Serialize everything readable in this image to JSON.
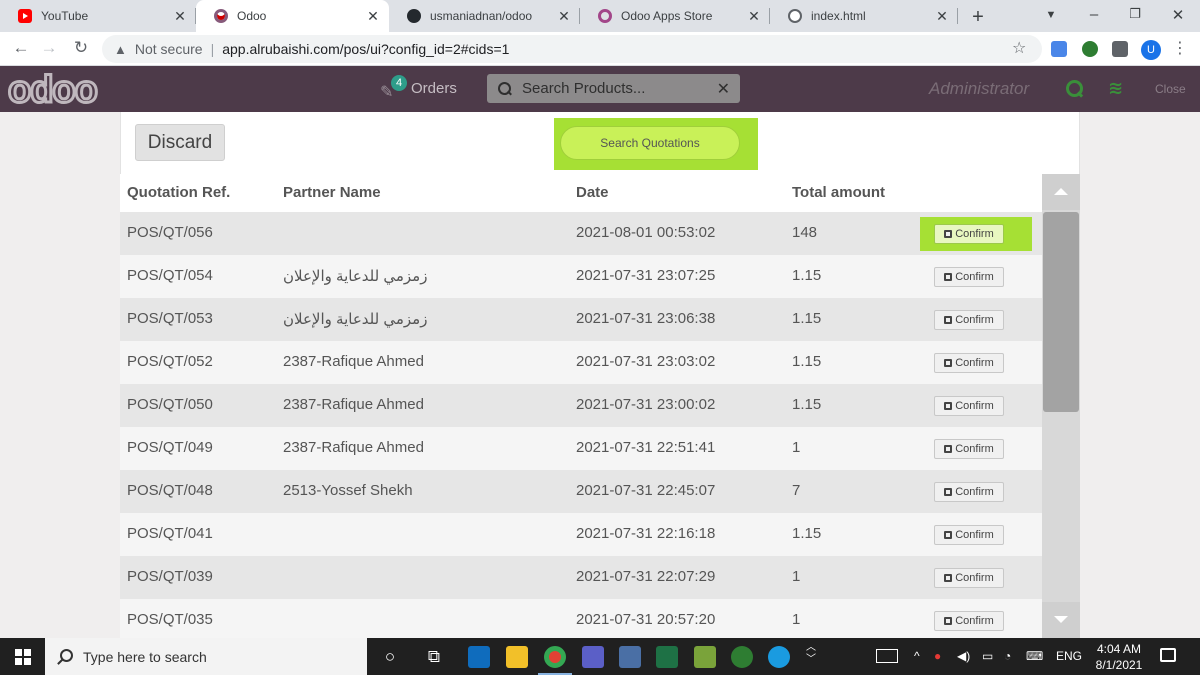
{
  "browser": {
    "tabs": [
      {
        "title": "YouTube",
        "icon": "youtube-icon"
      },
      {
        "title": "Odoo",
        "icon": "odoo-icon"
      },
      {
        "title": "usmaniadnan/odoo",
        "icon": "github-icon"
      },
      {
        "title": "Odoo Apps Store",
        "icon": "odoo-apps-icon"
      },
      {
        "title": "index.html",
        "icon": "globe-icon"
      }
    ],
    "security_label": "Not secure",
    "url": "app.alrubaishi.com/pos/ui?config_id=2#cids=1"
  },
  "pos_header": {
    "logo_text": "odoo",
    "orders_label": "Orders",
    "orders_count": "4",
    "search_placeholder": "Search Products...",
    "user_name": "Administrator",
    "close_label": "Close"
  },
  "actions": {
    "discard_label": "Discard",
    "search_quotations_label": "Search Quotations",
    "confirm_label": "Confirm"
  },
  "table": {
    "columns": [
      "Quotation Ref.",
      "Partner Name",
      "Date",
      "Total amount"
    ],
    "rows": [
      {
        "ref": "POS/QT/056",
        "partner": "",
        "date": "2021-08-01 00:53:02",
        "total": "148"
      },
      {
        "ref": "POS/QT/054",
        "partner": "زمزمي للدعاية والإعلان",
        "date": "2021-07-31 23:07:25",
        "total": "1.15"
      },
      {
        "ref": "POS/QT/053",
        "partner": "زمزمي للدعاية والإعلان",
        "date": "2021-07-31 23:06:38",
        "total": "1.15"
      },
      {
        "ref": "POS/QT/052",
        "partner": "2387-Rafique Ahmed",
        "date": "2021-07-31 23:03:02",
        "total": "1.15"
      },
      {
        "ref": "POS/QT/050",
        "partner": "2387-Rafique Ahmed",
        "date": "2021-07-31 23:00:02",
        "total": "1.15"
      },
      {
        "ref": "POS/QT/049",
        "partner": "2387-Rafique Ahmed",
        "date": "2021-07-31 22:51:41",
        "total": "1"
      },
      {
        "ref": "POS/QT/048",
        "partner": "2513-Yossef Shekh",
        "date": "2021-07-31 22:45:07",
        "total": "7"
      },
      {
        "ref": "POS/QT/041",
        "partner": "",
        "date": "2021-07-31 22:16:18",
        "total": "1.15"
      },
      {
        "ref": "POS/QT/039",
        "partner": "",
        "date": "2021-07-31 22:07:29",
        "total": "1"
      },
      {
        "ref": "POS/QT/035",
        "partner": "",
        "date": "2021-07-31 20:57:20",
        "total": "1"
      }
    ]
  },
  "taskbar": {
    "search_placeholder": "Type here to search",
    "language": "ENG",
    "time": "4:04 AM",
    "date": "8/1/2021"
  },
  "colors": {
    "pos_header_bg": "#4d3a49",
    "highlight": "#a6e034",
    "button_green": "#c9f158"
  }
}
